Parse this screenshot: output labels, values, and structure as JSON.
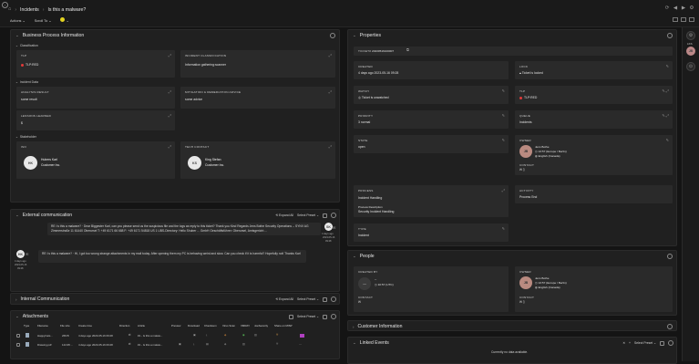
{
  "header": {
    "breadcrumb": [
      "Incidents",
      "Is this a malware?"
    ],
    "actions_label": "Actions",
    "scroll_label": "Scroll To",
    "status_dot_color": "#e3d321",
    "icons": [
      "home-icon",
      "refresh-icon",
      "back-icon",
      "forward-icon",
      "settings-icon"
    ]
  },
  "business_process": {
    "title": "Business Process Information",
    "classification": {
      "title": "Classification",
      "tlp_label": "TLP",
      "tlp_value": "TLP:RED",
      "incident_class_label": "INCIDENT CLASSIFICATION",
      "incident_class_value": "Information gathering:scanner"
    },
    "incident_data": {
      "title": "Incident Data",
      "analysis_label": "ANALYSIS RESULT",
      "analysis_value": "some result",
      "mitigation_label": "MITIGATION & REMEDIATION ADVICE",
      "mitigation_value": "some advice",
      "lessons_label": "LESSONS LEARNED",
      "lessons_value": "$"
    },
    "stakeholder": {
      "title": "Stakeholder",
      "iso_label": "ISO",
      "iso_initials": "HK",
      "iso_name": "Hubers Karl",
      "iso_org": "Customer Inc.",
      "tech_label": "TECH CONTACT",
      "tech_initials": "KS",
      "tech_name": "King Stefan",
      "tech_org": "Customer Inc."
    }
  },
  "external_comm": {
    "title": "External communication",
    "expand_all": "Expand All",
    "select_preset": "Select Preset",
    "messages": [
      {
        "initials": "SK",
        "date": "4 days ago",
        "date2": "2023-05-16",
        "time": "09:28",
        "text": "RE: Is this a malware? · Dear Biggester Karl,  can you please send us the suspicious file and the logs as reply to this ticket? Thank you Kind Regards Jens Bothe Security Operations -- SYNV AG Zimmerstraße 11 61440 Oberursel T: +49 6171 66 688 F: +49 6171 54818 US 1 UBS-Directory: Hello Shuber ... GmbH Geschäftsführer: Oberursel, Amtsgericht:..."
      },
      {
        "initials": "HK",
        "date": "4 days ago",
        "date2": "2023-05-16",
        "time": "09:28",
        "text": "RE: Is this a malware? · Hi, I got too wrong strange attachments in my mail today. After opening them my PC is behaving weird and slow. Can you check if it is harmful? Hopefully not! Thanks Karl"
      }
    ]
  },
  "internal_comm": {
    "title": "Internal Communication",
    "expand_all": "Expand All",
    "select_preset": "Select Preset"
  },
  "attachments": {
    "title": "Attachments",
    "select_preset": "Select Preset",
    "columns": [
      "Type",
      "Filename",
      "File size",
      "Create time",
      "Direction",
      "Article",
      "Preview",
      "Download",
      "Checksum",
      "Virus Scan",
      "VMRAY",
      "JoeSecurity",
      "Share on MISP"
    ],
    "rows": [
      {
        "file": "HappyCats...",
        "size": "269 B",
        "created": "4 days ago  2023-05-16 09:28",
        "article": "#1 - Is this a malwa..."
      },
      {
        "file": "Drawing.pdf",
        "size": "124.95 ...",
        "created": "4 days ago  2023-05-16 09:28",
        "article": "#1 - Is this a malwa..."
      }
    ]
  },
  "properties": {
    "title": "Properties",
    "ticket_label": "TICKET#",
    "ticket_value": "20230516100007",
    "created_label": "CREATED",
    "created_value": "4 days ago  2023-05-16 09:28",
    "lock_label": "LOCK",
    "lock_value": "Ticket is locked",
    "watch_label": "WATCH",
    "watch_value": "Ticket is unwatched",
    "tlp_label": "TLP",
    "tlp_value": "TLP:RED",
    "priority_label": "PRIORITY",
    "priority_value": "3 normal",
    "queue_label": "QUEUE",
    "queue_value": "Incidents",
    "state_label": "STATE",
    "state_value": "open",
    "owner_label": "OWNER",
    "owner_name": "Jens Bothe",
    "owner_time": "13:57 (Europe / Berlin)",
    "owner_lang": "English (Canada)",
    "contact_label": "CONTACT",
    "process_label": "PROCESS",
    "process_value": "Incident Handling",
    "process_desc_label": "Process Description",
    "process_desc_value": "Security Incident Handling",
    "activity_label": "ACTIVITY",
    "activity_value": "Process End",
    "type_label": "TYPE",
    "type_value": "Incident"
  },
  "people": {
    "title": "People",
    "created_by_label": "CREATED BY",
    "created_by_dash": "--",
    "created_by_time": "10:57 (UTC)",
    "contact_label": "CONTACT",
    "owner_label": "OWNER",
    "owner_name": "Jens Bothe",
    "owner_time": "13:57 (Europe / Berlin)",
    "owner_lang": "English (Canada)",
    "owner_contact_label": "CONTACT"
  },
  "customer": {
    "title": "Customer Information"
  },
  "linked": {
    "title": "Linked Events",
    "select_preset": "Select Preset",
    "empty": "Currently no data available."
  },
  "sidebar": {
    "top_label": "LKS"
  }
}
